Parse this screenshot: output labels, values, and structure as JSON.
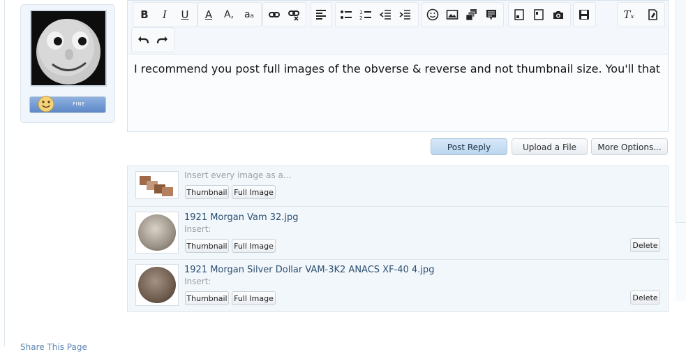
{
  "user": {
    "badge_label": "FINE"
  },
  "editor": {
    "content": "I recommend you post full images of the obverse & reverse and not thumbnail size. You'll that"
  },
  "toolbar": {
    "buttons": [
      "bold-icon",
      "italic-icon",
      "underline-icon",
      "text-color-icon",
      "font-size-icon",
      "font-family-icon",
      "link-icon",
      "unlink-icon",
      "align-icon",
      "bullet-list-icon",
      "numbered-list-icon",
      "outdent-icon",
      "indent-icon",
      "smilie-icon",
      "image-icon",
      "media-icon",
      "quote-icon",
      "code-icon",
      "php-icon",
      "camera-icon",
      "save-icon",
      "remove-format-icon",
      "toggle-bbcode-icon",
      "undo-icon",
      "redo-icon"
    ]
  },
  "actions": {
    "post_reply": "Post Reply",
    "upload_file": "Upload a File",
    "more_options": "More Options..."
  },
  "attachments": {
    "insert_all_hint": "Insert every image as a...",
    "thumbnail_label": "Thumbnail",
    "full_image_label": "Full Image",
    "insert_label": "Insert:",
    "delete_label": "Delete",
    "files": [
      {
        "name": "1921 Morgan Vam 32.jpg"
      },
      {
        "name": "1921 Morgan Silver Dollar VAM-3K2 ANACS XF-40 4.jpg"
      }
    ]
  },
  "footer": {
    "share_text": "Share This Page"
  },
  "colors": {
    "link": "#2d4f72",
    "accent": "#bcd6ee"
  }
}
